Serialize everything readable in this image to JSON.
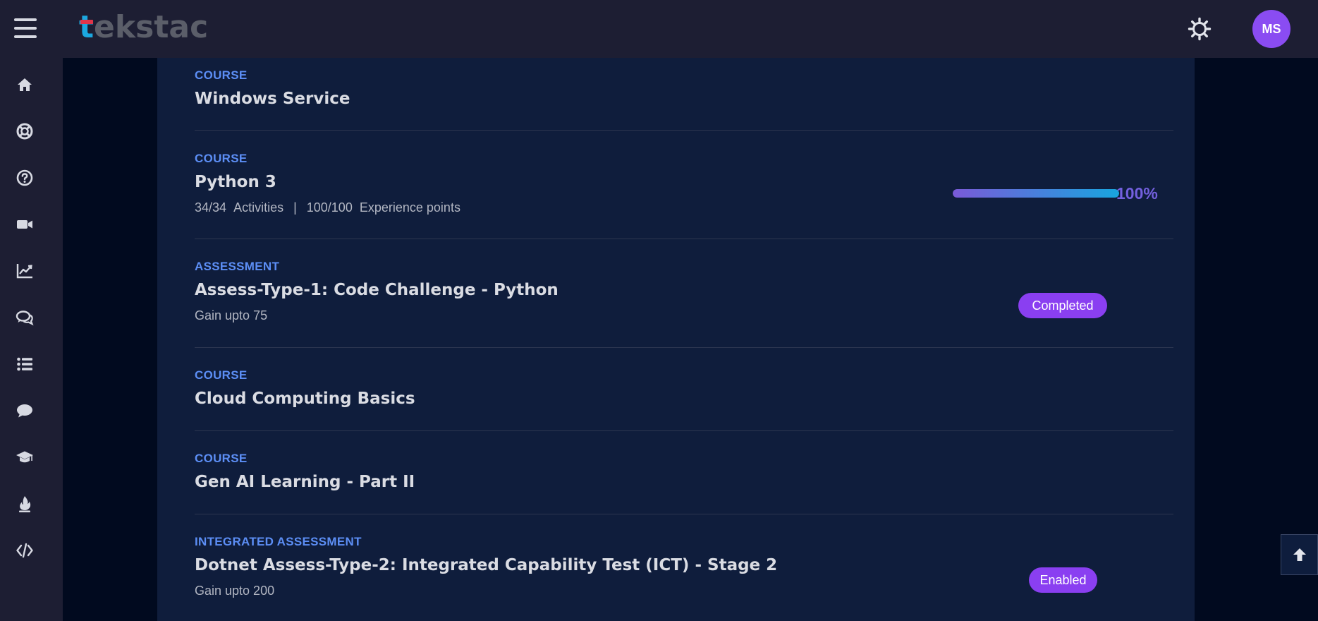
{
  "header": {
    "logo_first": "t",
    "logo_rest": "ekstac",
    "avatar_initials": "MS",
    "icons": [
      "menu-icon",
      "settings-icon"
    ]
  },
  "sidebar": {
    "icons": [
      "home-icon",
      "lifebuoy-icon",
      "help-icon",
      "video-icon",
      "chart-icon",
      "chat-bubbles-icon",
      "list-icon",
      "comment-icon",
      "graduation-cap-icon",
      "fire-icon",
      "code-icon"
    ]
  },
  "items": [
    {
      "type": "COURSE",
      "title": "Windows Service"
    },
    {
      "type": "COURSE",
      "title": "Python 3",
      "activities": "34/34",
      "activities_label": "Activities",
      "separator": "|",
      "xp": "100/100",
      "xp_label": "Experience points",
      "progress_percent": 100,
      "progress_label": "100%"
    },
    {
      "type": "ASSESSMENT",
      "title": "Assess-Type-1: Code Challenge - Python",
      "sub": "Gain upto 75",
      "status": "Completed"
    },
    {
      "type": "COURSE",
      "title": "Cloud Computing Basics"
    },
    {
      "type": "COURSE",
      "title": "Gen AI Learning - Part II"
    },
    {
      "type": "INTEGRATED ASSESSMENT",
      "title": "Dotnet Assess-Type-2: Integrated Capability Test (ICT) - Stage 2",
      "sub": "Gain upto 200",
      "status": "Enabled"
    }
  ],
  "colors": {
    "accent": "#8a3ff1",
    "type_label": "#5c8ef5",
    "progress_start": "#7a5ad8",
    "progress_end": "#18a5df"
  }
}
